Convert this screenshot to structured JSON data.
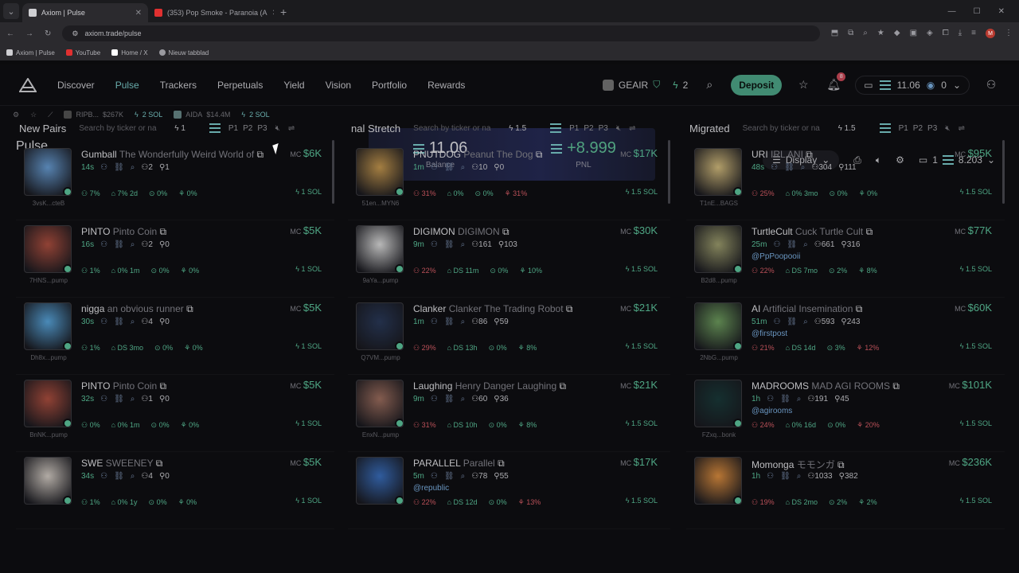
{
  "browser": {
    "tabs": [
      {
        "title": "Axiom | Pulse",
        "active": true,
        "fav_color": "#cfcfd3"
      },
      {
        "title": "(353) Pop Smoke - Paranoia (A",
        "active": false,
        "fav_color": "#e03030"
      }
    ],
    "url": "axiom.trade/pulse",
    "profile": "M",
    "bookmarks": [
      {
        "label": "Axiom | Pulse",
        "color": "#cfcfd3"
      },
      {
        "label": "YouTube",
        "color": "#e03030"
      },
      {
        "label": "Home / X",
        "color": "#ffffff"
      },
      {
        "label": "Nieuw tabblad",
        "color": "#9a9aa0"
      }
    ]
  },
  "nav": {
    "links": [
      "Discover",
      "Pulse",
      "Trackers",
      "Perpetuals",
      "Yield",
      "Vision",
      "Portfolio",
      "Rewards"
    ],
    "active": "Pulse",
    "user_tag": "GEAIR",
    "points": "2",
    "deposit": "Deposit",
    "notif_count": "8",
    "wallet_balance": "11.06",
    "wallet_secondary": "0"
  },
  "ticker": [
    {
      "name": "RIPB...",
      "mc": "$267K",
      "sol": "2 SOL"
    },
    {
      "name": "AIDA",
      "mc": "$14.4M",
      "sol": "2 SOL"
    }
  ],
  "pulse": {
    "title": "Pulse",
    "balance": "11.06",
    "balance_label": "Balance",
    "pnl": "+8.999",
    "pnl_label": "PNL",
    "display": "Display",
    "wallets": "1",
    "wallet_amount": "8.203"
  },
  "columns": [
    {
      "title": "New Pairs",
      "search": "Search by ticker or na",
      "amount": "1",
      "presets": [
        "P1",
        "P2",
        "P3"
      ],
      "cards": [
        {
          "ticker": "Gumball",
          "name": "The Wonderfully Weird World of",
          "age": "14s",
          "holders": "2",
          "pro": "1",
          "handle": "",
          "stats": [
            [
              "7%",
              "green"
            ],
            [
              "7% 2d",
              "green"
            ],
            [
              "0%",
              "green"
            ],
            [
              "0%",
              "green"
            ]
          ],
          "mc": "$6K",
          "buy": "1 SOL",
          "addr": "3vsK...cteB",
          "color": "#6aa0d8"
        },
        {
          "ticker": "PINTO",
          "name": "Pinto Coin",
          "age": "16s",
          "holders": "2",
          "pro": "0",
          "handle": "",
          "stats": [
            [
              "1%",
              "green"
            ],
            [
              "0% 1m",
              "green"
            ],
            [
              "0%",
              "green"
            ],
            [
              "0%",
              "green"
            ]
          ],
          "mc": "$5K",
          "buy": "1 SOL",
          "addr": "7HNS...pump",
          "color": "#b05040"
        },
        {
          "ticker": "nigga",
          "name": "an obvious runner",
          "age": "30s",
          "holders": "4",
          "pro": "0",
          "handle": "",
          "stats": [
            [
              "1%",
              "green"
            ],
            [
              "DS 3mo",
              "green"
            ],
            [
              "0%",
              "green"
            ],
            [
              "0%",
              "green"
            ]
          ],
          "mc": "$5K",
          "buy": "1 SOL",
          "addr": "Dh8x...pump",
          "color": "#5aa8e0"
        },
        {
          "ticker": "PINTO",
          "name": "Pinto Coin",
          "age": "32s",
          "holders": "1",
          "pro": "0",
          "handle": "",
          "stats": [
            [
              "0%",
              "green"
            ],
            [
              "0% 1m",
              "green"
            ],
            [
              "0%",
              "green"
            ],
            [
              "0%",
              "green"
            ]
          ],
          "mc": "$5K",
          "buy": "1 SOL",
          "addr": "BnNK...pump",
          "color": "#b05040"
        },
        {
          "ticker": "SWE",
          "name": "SWEENEY",
          "age": "34s",
          "holders": "4",
          "pro": "0",
          "handle": "",
          "stats": [
            [
              "1%",
              "green"
            ],
            [
              "0% 1y",
              "green"
            ],
            [
              "0%",
              "green"
            ],
            [
              "0%",
              "green"
            ]
          ],
          "mc": "$5K",
          "buy": "1 SOL",
          "addr": "",
          "color": "#d8d0c8"
        }
      ]
    },
    {
      "title": "nal Stretch",
      "search": "Search by ticker or na",
      "amount": "1.5",
      "presets": [
        "P1",
        "P2",
        "P3"
      ],
      "cards": [
        {
          "ticker": "PNUTDOG",
          "name": "Peanut The Dog",
          "age": "1m",
          "holders": "10",
          "pro": "0",
          "handle": "",
          "stats": [
            [
              "31%",
              "red"
            ],
            [
              "0%",
              "green"
            ],
            [
              "0%",
              "green"
            ],
            [
              "31%",
              "red"
            ]
          ],
          "mc": "$17K",
          "buy": "1.5 SOL",
          "addr": "51en...MYN6",
          "color": "#c89a50"
        },
        {
          "ticker": "DIGIMON",
          "name": "DIGIMON",
          "age": "9m",
          "holders": "161",
          "pro": "103",
          "handle": "",
          "stats": [
            [
              "22%",
              "red"
            ],
            [
              "DS 11m",
              "green"
            ],
            [
              "0%",
              "green"
            ],
            [
              "10%",
              "green"
            ]
          ],
          "mc": "$30K",
          "buy": "1.5 SOL",
          "addr": "9aYa...pump",
          "color": "#e0e0e0"
        },
        {
          "ticker": "Clanker",
          "name": "Clanker The Trading Robot",
          "age": "1m",
          "holders": "86",
          "pro": "59",
          "handle": "",
          "stats": [
            [
              "29%",
              "red"
            ],
            [
              "DS 13h",
              "green"
            ],
            [
              "0%",
              "green"
            ],
            [
              "8%",
              "green"
            ]
          ],
          "mc": "$21K",
          "buy": "1.5 SOL",
          "addr": "Q7VM...pump",
          "color": "#2a3a5a"
        },
        {
          "ticker": "Laughing",
          "name": "Henry Danger Laughing",
          "age": "9m",
          "holders": "60",
          "pro": "36",
          "handle": "",
          "stats": [
            [
              "31%",
              "red"
            ],
            [
              "DS 10h",
              "green"
            ],
            [
              "0%",
              "green"
            ],
            [
              "8%",
              "green"
            ]
          ],
          "mc": "$21K",
          "buy": "1.5 SOL",
          "addr": "EnxN...pump",
          "color": "#a07060"
        },
        {
          "ticker": "PARALLEL",
          "name": "Parallel",
          "age": "5m",
          "holders": "78",
          "pro": "55",
          "handle": "@republic",
          "stats": [
            [
              "22%",
              "red"
            ],
            [
              "DS 12d",
              "green"
            ],
            [
              "0%",
              "green"
            ],
            [
              "13%",
              "red"
            ]
          ],
          "mc": "$17K",
          "buy": "1.5 SOL",
          "addr": "",
          "color": "#3a70c0"
        }
      ]
    },
    {
      "title": "Migrated",
      "search": "Search by ticker or na",
      "amount": "1.5",
      "presets": [
        "P1",
        "P2",
        "P3"
      ],
      "cards": [
        {
          "ticker": "URI",
          "name": "IRL ANI",
          "age": "48s",
          "holders": "304",
          "pro": "111",
          "handle": "",
          "stats": [
            [
              "25%",
              "red"
            ],
            [
              "0% 3mo",
              "green"
            ],
            [
              "0%",
              "green"
            ],
            [
              "0%",
              "green"
            ]
          ],
          "mc": "$95K",
          "buy": "1.5 SOL",
          "addr": "T1nE...BAGS",
          "color": "#d8c080"
        },
        {
          "ticker": "TurtleCult",
          "name": "Cuck Turtle Cult",
          "age": "25m",
          "holders": "661",
          "pro": "316",
          "handle": "@PpPoopooii",
          "stats": [
            [
              "22%",
              "red"
            ],
            [
              "DS 7mo",
              "green"
            ],
            [
              "2%",
              "green"
            ],
            [
              "8%",
              "green"
            ]
          ],
          "mc": "$77K",
          "buy": "1.5 SOL",
          "addr": "B2d8...pump",
          "color": "#a0a070"
        },
        {
          "ticker": "AI",
          "name": "Artificial Insemination",
          "age": "51m",
          "holders": "593",
          "pro": "243",
          "handle": "@firstpost",
          "stats": [
            [
              "21%",
              "red"
            ],
            [
              "DS 14d",
              "green"
            ],
            [
              "3%",
              "green"
            ],
            [
              "12%",
              "red"
            ]
          ],
          "mc": "$60K",
          "buy": "1.5 SOL",
          "addr": "2NbG...pump",
          "color": "#70a060"
        },
        {
          "ticker": "MADROOMS",
          "name": "MAD AGI ROOMS",
          "age": "1h",
          "holders": "191",
          "pro": "45",
          "handle": "@agirooms",
          "stats": [
            [
              "24%",
              "red"
            ],
            [
              "0% 16d",
              "green"
            ],
            [
              "0%",
              "green"
            ],
            [
              "20%",
              "red"
            ]
          ],
          "mc": "$101K",
          "buy": "1.5 SOL",
          "addr": "FZxq...bonk",
          "color": "#1a3a3a"
        },
        {
          "ticker": "Momonga",
          "name": "モモンガ",
          "age": "1h",
          "holders": "1033",
          "pro": "382",
          "handle": "",
          "stats": [
            [
              "19%",
              "red"
            ],
            [
              "DS 2mo",
              "green"
            ],
            [
              "2%",
              "green"
            ],
            [
              "2%",
              "green"
            ]
          ],
          "mc": "$236K",
          "buy": "1.5 SOL",
          "addr": "",
          "color": "#e09040"
        }
      ]
    }
  ]
}
